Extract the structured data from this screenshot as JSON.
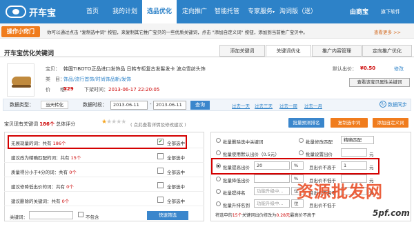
{
  "header": {
    "logo": "开车宝",
    "nav": [
      {
        "label": "首页",
        "active": false
      },
      {
        "label": "我的计划",
        "active": false
      },
      {
        "label": "选品优化",
        "active": true
      },
      {
        "label": "定向推广",
        "active": false
      },
      {
        "label": "智能托管",
        "active": false
      },
      {
        "label": "专家服务",
        "active": false
      },
      {
        "label": "淘词版（送）",
        "active": false
      }
    ],
    "partner": "由商宝",
    "flagship": "旗下软件"
  },
  "notice": {
    "badge": "操作小窍门",
    "text": "你可以通过点击 \"复制选中词\" 按钮，来复制其它推广宝贝的一些优质关键词，点击 \"添加自定义词\" 按钮，添加到当前推广宝贝中。",
    "more": "查看更多 >>"
  },
  "page": {
    "title": "开车宝优化关键词",
    "tabs": [
      "添加关键词",
      "关键词优化",
      "推广内容管理",
      "定向推广优化"
    ]
  },
  "product": {
    "labels": {
      "title": "宝贝：",
      "category": "类　目：",
      "price": "价　　格："
    },
    "title": "韩国TIBOTO正品进口发饰品 日韩专柜复古发髻发卡 波点雪纺头饰",
    "category": "饰品/流行首饰/时尚饰品新/发饰",
    "price": "¥29",
    "list_time_label": "下架时间：",
    "list_time": "2013-06-17 22:20:05",
    "default_bid_label": "默认出价：",
    "default_bid": "¥0.50",
    "edit": "修改",
    "view_keywords": "查看该宝贝属性关键词"
  },
  "filter": {
    "type_label": "数据类型：",
    "type_value": "当天转化",
    "period_label": "数据时段：",
    "date_from": "2013-06-11",
    "date_to": "2013-06-11",
    "dash": "-",
    "query": "查询",
    "quick": [
      "过去一天",
      "过去三天",
      "过去一周",
      "过去一月"
    ],
    "sync": "数据同步"
  },
  "stats": {
    "prefix": "宝贝现有关键词",
    "count": "186个",
    "score_label": "总体评分",
    "stars_on": "★",
    "stars_off": "★★★★",
    "hint": "( 点此查看详情及修改建议 )",
    "rating": 1
  },
  "actions": {
    "bulk_match": "批量预测排名",
    "copy": "复制选中词",
    "add_custom": "添加自定义词"
  },
  "left_rows": [
    {
      "text": "无展现量的词：共有",
      "count": "186个",
      "checked": true,
      "select": "全部选中"
    },
    {
      "text": "建议改为精确匹配的词：共有",
      "count": "15个",
      "checked": false,
      "select": "全部选中"
    },
    {
      "text": "质量得分小于4分的词：共有",
      "count": "0个",
      "checked": false,
      "select": "全部选中"
    },
    {
      "text": "建议修降低出价的词：共有",
      "count": "0个",
      "checked": false,
      "select": "全部选中"
    },
    {
      "text": "建议删除的关键词：共有",
      "count": "0个",
      "checked": false,
      "select": "全部选中"
    }
  ],
  "kw_filter": {
    "label": "关键词：",
    "exclude": "不包含",
    "button": "快速筛选"
  },
  "right": {
    "delete": "批量删除选中关键词",
    "modify_match": "批量修改匹配",
    "match_value": "精确匹配",
    "use_default": "批量使用默认出价（0.5元）",
    "set_bid": "批量设置出价",
    "raise_bid": "批量提高出价",
    "raise_value": "20",
    "percent": "%",
    "not_exceed": "且出价不高于",
    "max_value": "1",
    "yuan": "元",
    "lower_bid": "批量降低出价",
    "not_lower": "且出价不低于",
    "up_rank": "批量提排名",
    "down_rank": "批量升排名到",
    "upgrading": "功能升级中...",
    "unit": "位",
    "summary_pre": "将选中的",
    "summary_count": "15个",
    "summary_mid": "关键词出价修改为",
    "summary_price": "0.28元",
    "summary_end": "最高价不高于"
  },
  "watermark": {
    "main": "资源批发网",
    "site": "5pf.com"
  }
}
